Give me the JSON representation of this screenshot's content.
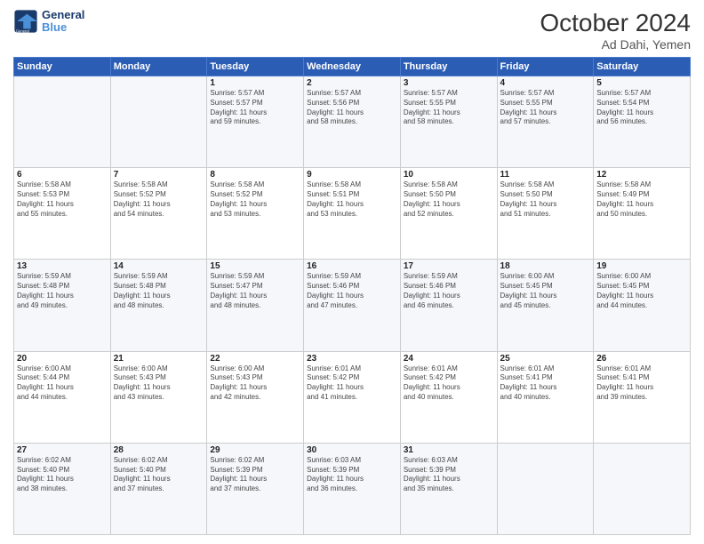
{
  "header": {
    "logo_line1": "General",
    "logo_line2": "Blue",
    "title": "October 2024",
    "location": "Ad Dahi, Yemen"
  },
  "weekdays": [
    "Sunday",
    "Monday",
    "Tuesday",
    "Wednesday",
    "Thursday",
    "Friday",
    "Saturday"
  ],
  "weeks": [
    [
      {
        "day": "",
        "detail": ""
      },
      {
        "day": "",
        "detail": ""
      },
      {
        "day": "1",
        "detail": "Sunrise: 5:57 AM\nSunset: 5:57 PM\nDaylight: 11 hours\nand 59 minutes."
      },
      {
        "day": "2",
        "detail": "Sunrise: 5:57 AM\nSunset: 5:56 PM\nDaylight: 11 hours\nand 58 minutes."
      },
      {
        "day": "3",
        "detail": "Sunrise: 5:57 AM\nSunset: 5:55 PM\nDaylight: 11 hours\nand 58 minutes."
      },
      {
        "day": "4",
        "detail": "Sunrise: 5:57 AM\nSunset: 5:55 PM\nDaylight: 11 hours\nand 57 minutes."
      },
      {
        "day": "5",
        "detail": "Sunrise: 5:57 AM\nSunset: 5:54 PM\nDaylight: 11 hours\nand 56 minutes."
      }
    ],
    [
      {
        "day": "6",
        "detail": "Sunrise: 5:58 AM\nSunset: 5:53 PM\nDaylight: 11 hours\nand 55 minutes."
      },
      {
        "day": "7",
        "detail": "Sunrise: 5:58 AM\nSunset: 5:52 PM\nDaylight: 11 hours\nand 54 minutes."
      },
      {
        "day": "8",
        "detail": "Sunrise: 5:58 AM\nSunset: 5:52 PM\nDaylight: 11 hours\nand 53 minutes."
      },
      {
        "day": "9",
        "detail": "Sunrise: 5:58 AM\nSunset: 5:51 PM\nDaylight: 11 hours\nand 53 minutes."
      },
      {
        "day": "10",
        "detail": "Sunrise: 5:58 AM\nSunset: 5:50 PM\nDaylight: 11 hours\nand 52 minutes."
      },
      {
        "day": "11",
        "detail": "Sunrise: 5:58 AM\nSunset: 5:50 PM\nDaylight: 11 hours\nand 51 minutes."
      },
      {
        "day": "12",
        "detail": "Sunrise: 5:58 AM\nSunset: 5:49 PM\nDaylight: 11 hours\nand 50 minutes."
      }
    ],
    [
      {
        "day": "13",
        "detail": "Sunrise: 5:59 AM\nSunset: 5:48 PM\nDaylight: 11 hours\nand 49 minutes."
      },
      {
        "day": "14",
        "detail": "Sunrise: 5:59 AM\nSunset: 5:48 PM\nDaylight: 11 hours\nand 48 minutes."
      },
      {
        "day": "15",
        "detail": "Sunrise: 5:59 AM\nSunset: 5:47 PM\nDaylight: 11 hours\nand 48 minutes."
      },
      {
        "day": "16",
        "detail": "Sunrise: 5:59 AM\nSunset: 5:46 PM\nDaylight: 11 hours\nand 47 minutes."
      },
      {
        "day": "17",
        "detail": "Sunrise: 5:59 AM\nSunset: 5:46 PM\nDaylight: 11 hours\nand 46 minutes."
      },
      {
        "day": "18",
        "detail": "Sunrise: 6:00 AM\nSunset: 5:45 PM\nDaylight: 11 hours\nand 45 minutes."
      },
      {
        "day": "19",
        "detail": "Sunrise: 6:00 AM\nSunset: 5:45 PM\nDaylight: 11 hours\nand 44 minutes."
      }
    ],
    [
      {
        "day": "20",
        "detail": "Sunrise: 6:00 AM\nSunset: 5:44 PM\nDaylight: 11 hours\nand 44 minutes."
      },
      {
        "day": "21",
        "detail": "Sunrise: 6:00 AM\nSunset: 5:43 PM\nDaylight: 11 hours\nand 43 minutes."
      },
      {
        "day": "22",
        "detail": "Sunrise: 6:00 AM\nSunset: 5:43 PM\nDaylight: 11 hours\nand 42 minutes."
      },
      {
        "day": "23",
        "detail": "Sunrise: 6:01 AM\nSunset: 5:42 PM\nDaylight: 11 hours\nand 41 minutes."
      },
      {
        "day": "24",
        "detail": "Sunrise: 6:01 AM\nSunset: 5:42 PM\nDaylight: 11 hours\nand 40 minutes."
      },
      {
        "day": "25",
        "detail": "Sunrise: 6:01 AM\nSunset: 5:41 PM\nDaylight: 11 hours\nand 40 minutes."
      },
      {
        "day": "26",
        "detail": "Sunrise: 6:01 AM\nSunset: 5:41 PM\nDaylight: 11 hours\nand 39 minutes."
      }
    ],
    [
      {
        "day": "27",
        "detail": "Sunrise: 6:02 AM\nSunset: 5:40 PM\nDaylight: 11 hours\nand 38 minutes."
      },
      {
        "day": "28",
        "detail": "Sunrise: 6:02 AM\nSunset: 5:40 PM\nDaylight: 11 hours\nand 37 minutes."
      },
      {
        "day": "29",
        "detail": "Sunrise: 6:02 AM\nSunset: 5:39 PM\nDaylight: 11 hours\nand 37 minutes."
      },
      {
        "day": "30",
        "detail": "Sunrise: 6:03 AM\nSunset: 5:39 PM\nDaylight: 11 hours\nand 36 minutes."
      },
      {
        "day": "31",
        "detail": "Sunrise: 6:03 AM\nSunset: 5:39 PM\nDaylight: 11 hours\nand 35 minutes."
      },
      {
        "day": "",
        "detail": ""
      },
      {
        "day": "",
        "detail": ""
      }
    ]
  ]
}
